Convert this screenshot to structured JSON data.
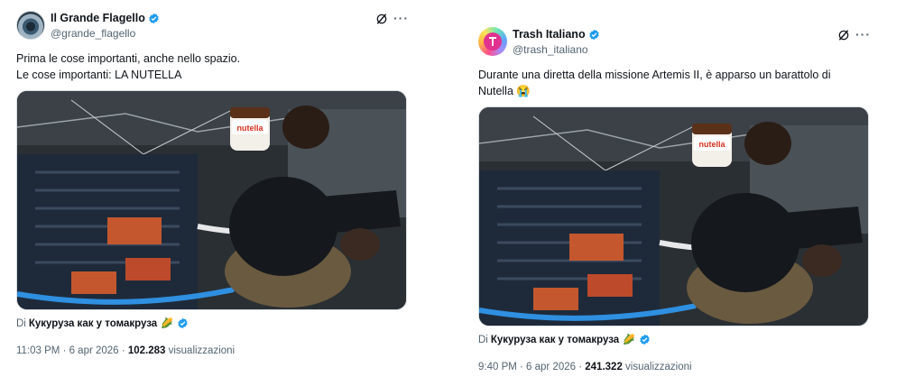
{
  "tweets": [
    {
      "display_name": "Il Grande Flagello",
      "handle": "@grande_flagello",
      "text_lines": [
        "Prima le cose importanti, anche nello spazio.",
        "Le cose importanti: LA NUTELLA"
      ],
      "media_label": "nutella",
      "attribution_prefix": "Di",
      "attribution_author": "Кукуруза как у томакруза",
      "attribution_emoji": "🌽",
      "time": "11:03 PM · 6 apr 2026 ·",
      "views_count": "102.283",
      "views_label": "visualizzazioni"
    },
    {
      "display_name": "Trash Italiano",
      "handle": "@trash_italiano",
      "text_lines": [
        "Durante una diretta della missione Artemis II, è apparso un barattolo di",
        "Nutella 😭"
      ],
      "media_label": "nutella",
      "attribution_prefix": "Di",
      "attribution_author": "Кукуруза как у томакруза",
      "attribution_emoji": "🌽",
      "time": "9:40 PM · 6 apr 2026 ·",
      "views_count": "241.322",
      "views_label": "visualizzazioni"
    }
  ],
  "icons": {
    "verified": "verified-badge-icon",
    "grok": "grok-icon",
    "more": "more-options-icon"
  },
  "colors": {
    "verified_blue": "#1d9bf0",
    "secondary_text": "#536471",
    "primary_text": "#0f1419"
  }
}
